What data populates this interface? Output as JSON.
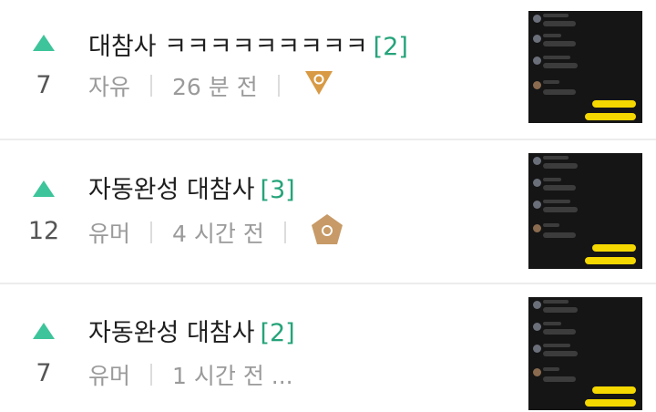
{
  "posts": [
    {
      "votes": "7",
      "title": "대참사 ㅋㅋㅋㅋㅋㅋㅋㅋㅋ",
      "comments": "[2]",
      "category": "자유",
      "time": "26 분 전",
      "badge_icon": "orange-triangle-badge-icon",
      "thumbnail_icon": "chat-screenshot-thumbnail"
    },
    {
      "votes": "12",
      "title": "자동완성 대참사",
      "comments": "[3]",
      "category": "유머",
      "time": "4 시간 전",
      "badge_icon": "pentagon-badge-icon",
      "thumbnail_icon": "chat-screenshot-thumbnail"
    },
    {
      "votes": "7",
      "title": "자동완성 대참사",
      "comments": "[2]",
      "category": "유머",
      "time": "1 시간 전 ...",
      "thumbnail_icon": "chat-screenshot-thumbnail"
    }
  ],
  "colors": {
    "upvote": "#3ec49a",
    "comment_count": "#25a37a",
    "meta_text": "#9a9a9a",
    "badge_orange": "#d89a45",
    "badge_tan": "#c79a67"
  }
}
